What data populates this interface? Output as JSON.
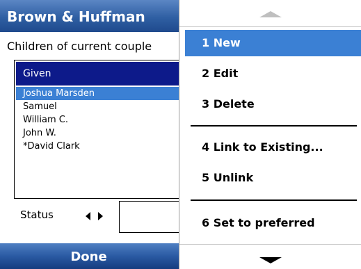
{
  "window": {
    "title": "Brown & Huffman"
  },
  "section": {
    "header": "Children of current couple"
  },
  "list": {
    "column_header": "Given",
    "rows": [
      "Joshua Marsden",
      "Samuel",
      "William C.",
      "John W.",
      "*David Clark"
    ],
    "selected_index": 0
  },
  "status": {
    "label": "Status",
    "left_arrow_icon": "triangle-left-icon",
    "right_arrow_icon": "triangle-right-icon",
    "value": ""
  },
  "softkeys": {
    "left_label": "Done"
  },
  "menu": {
    "scroll_up_icon": "scroll-up-arrow-icon",
    "scroll_down_icon": "scroll-down-arrow-icon",
    "items": [
      {
        "label": "1 New",
        "selected": true
      },
      {
        "label": "2 Edit",
        "selected": false
      },
      {
        "label": "3 Delete",
        "selected": false
      },
      {
        "label": "4 Link to Existing...",
        "selected": false
      },
      {
        "label": "5 Unlink",
        "selected": false
      },
      {
        "label": "6 Set to preferred",
        "selected": false
      }
    ]
  },
  "colors": {
    "title_bar": "#2f5fa3",
    "selection": "#3b80d4",
    "list_header": "#0d1a8a"
  }
}
